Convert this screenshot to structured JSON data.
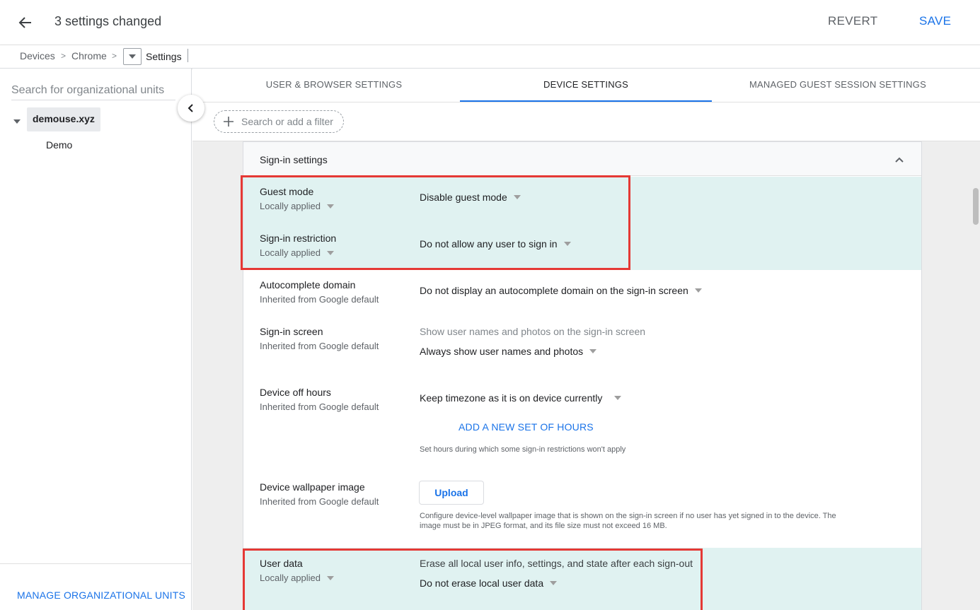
{
  "header": {
    "title": "3 settings changed",
    "revert_label": "REVERT",
    "save_label": "SAVE"
  },
  "breadcrumb": {
    "items": [
      "Devices",
      "Chrome"
    ],
    "current": "Settings"
  },
  "left_panel": {
    "search_placeholder": "Search for organizational units",
    "root_unit": "demouse.xyz",
    "child_unit": "Demo",
    "manage_label": "MANAGE ORGANIZATIONAL UNITS"
  },
  "tabs": [
    {
      "label": "USER & BROWSER SETTINGS"
    },
    {
      "label": "DEVICE SETTINGS"
    },
    {
      "label": "MANAGED GUEST SESSION SETTINGS"
    }
  ],
  "filter": {
    "placeholder": "Search or add a filter"
  },
  "section": {
    "title": "Sign-in settings"
  },
  "settings": {
    "guest_mode": {
      "label": "Guest mode",
      "source": "Locally applied",
      "value": "Disable guest mode"
    },
    "signin_restriction": {
      "label": "Sign-in restriction",
      "source": "Locally applied",
      "value": "Do not allow any user to sign in"
    },
    "autocomplete_domain": {
      "label": "Autocomplete domain",
      "source": "Inherited from Google default",
      "value": "Do not display an autocomplete domain on the sign-in screen"
    },
    "signin_screen": {
      "label": "Sign-in screen",
      "source": "Inherited from Google default",
      "description": "Show user names and photos on the sign-in screen",
      "value": "Always show user names and photos"
    },
    "device_off_hours": {
      "label": "Device off hours",
      "source": "Inherited from Google default",
      "value": "Keep timezone as it is on device currently",
      "add_hours_label": "ADD A NEW SET OF HOURS",
      "help": "Set hours during which some sign-in restrictions won't apply"
    },
    "wallpaper": {
      "label": "Device wallpaper image",
      "source": "Inherited from Google default",
      "upload_label": "Upload",
      "help_line1": "Configure device-level wallpaper image that is shown on the sign-in screen if no user has yet signed in to the device. The",
      "help_line2": "image must be in JPEG format, and its file size must not exceed 16 MB."
    },
    "user_data": {
      "label": "User data",
      "source": "Locally applied",
      "description": "Erase all local user info, settings, and state after each sign-out",
      "value": "Do not erase local user data"
    }
  },
  "colors": {
    "accent": "#1a73e8",
    "highlight_row": "#e0f2f1",
    "annotation_box": "#e53935"
  }
}
